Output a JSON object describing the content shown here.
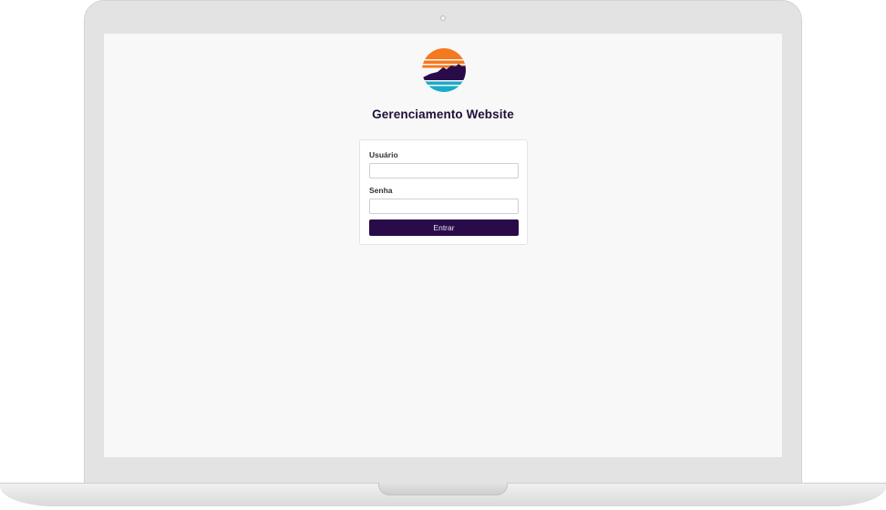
{
  "page": {
    "title": "Gerenciamento Website"
  },
  "logo": {
    "icon": "sunset-mountain-logo",
    "colors": [
      "#f4791f",
      "#2a0b4a",
      "#1aa9c9"
    ]
  },
  "form": {
    "username_label": "Usuário",
    "username_value": "",
    "password_label": "Senha",
    "password_value": "",
    "submit_label": "Entrar"
  },
  "colors": {
    "accent": "#2a0b4a",
    "title": "#1f1138",
    "background": "#f8f8f8"
  }
}
